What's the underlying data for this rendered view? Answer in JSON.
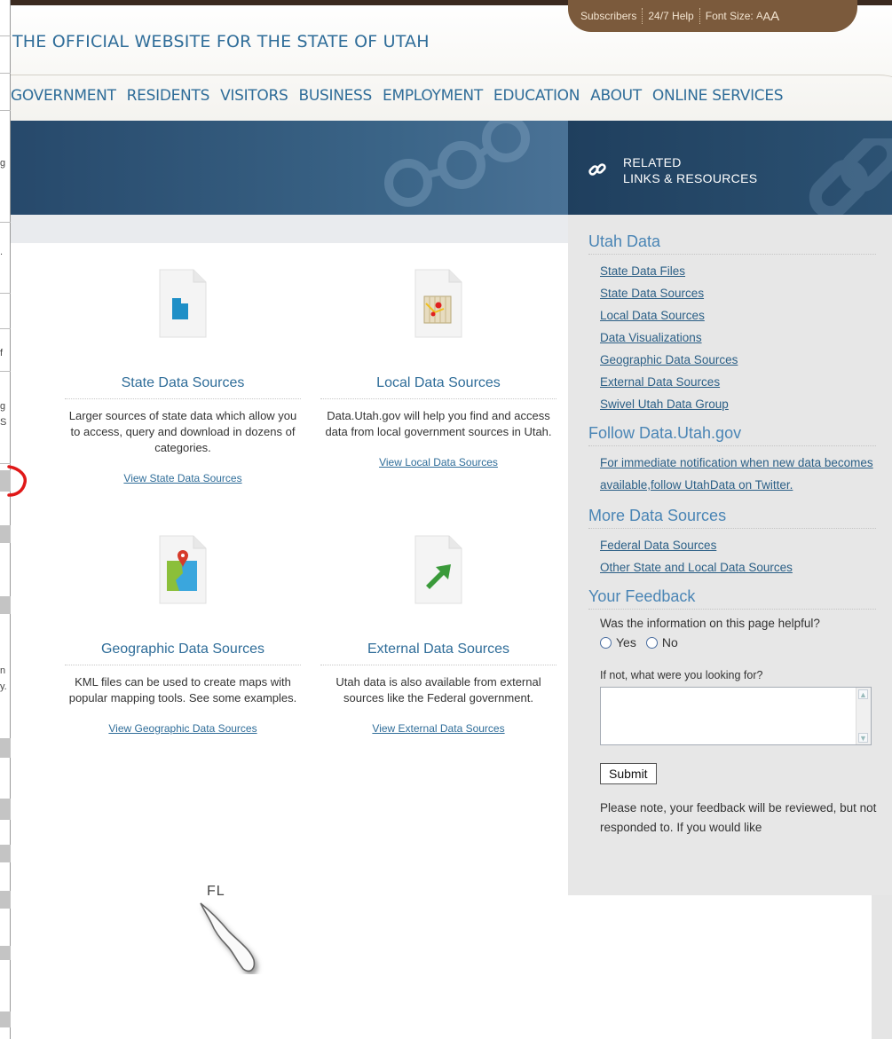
{
  "header": {
    "tagline": "THE OFFICIAL WEBSITE FOR THE STATE OF UTAH",
    "utility": {
      "subscribers": "Subscribers",
      "help": "24/7 Help",
      "font_size_label": "Font Size:",
      "font_sizes": [
        "A",
        "A",
        "A"
      ]
    },
    "nav": [
      "GOVERNMENT",
      "RESIDENTS",
      "VISITORS",
      "BUSINESS",
      "EMPLOYMENT",
      "EDUCATION",
      "ABOUT",
      "ONLINE SERVICES"
    ]
  },
  "related": {
    "title_line1": "RELATED",
    "title_line2": "LINKS & RESOURCES"
  },
  "cards": [
    {
      "title": "State Data Sources",
      "description": "Larger sources of state data which allow you to access, query and download in dozens of categories.",
      "link": "View State Data Sources"
    },
    {
      "title": "Local Data Sources",
      "description": "Data.Utah.gov will help you find and access data from local government sources in Utah.",
      "link": "View Local Data Sources"
    },
    {
      "title": "Geographic Data Sources",
      "description": "KML files can be used to create maps with popular mapping tools. See some examples.",
      "link": "View Geographic Data Sources"
    },
    {
      "title": "External Data Sources",
      "description": "Utah data is also available from external sources like the Federal government.",
      "link": "View External Data Sources"
    }
  ],
  "sidebar": {
    "utah_data": {
      "heading": "Utah Data",
      "links": [
        "State Data Files",
        "State Data Sources",
        "Local Data Sources",
        "Data Visualizations",
        "Geographic Data Sources",
        "External Data Sources",
        "Swivel Utah Data Group"
      ]
    },
    "follow": {
      "heading": "Follow Data.Utah.gov",
      "text": "For immediate notification when new data becomes available,follow UtahData on Twitter."
    },
    "more": {
      "heading": "More Data Sources",
      "links": [
        "Federal Data Sources",
        "Other State and Local Data Sources"
      ]
    },
    "feedback": {
      "heading": "Your Feedback",
      "question": "Was the information on this page helpful?",
      "yes": "Yes",
      "no": "No",
      "prompt": "If not, what were you looking for?",
      "submit": "Submit",
      "note": "Please note, your feedback will be reviewed, but not responded to. If you would like"
    }
  },
  "left_strip_chars": [
    "g",
    ".",
    "f",
    "g",
    "S",
    "n",
    "y."
  ],
  "overlay": {
    "map_label": "FL"
  }
}
